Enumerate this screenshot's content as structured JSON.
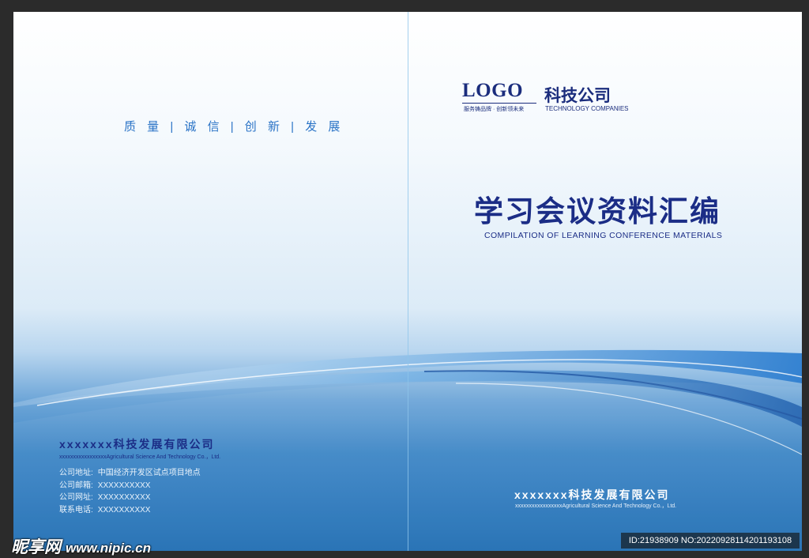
{
  "back_cover": {
    "slogan": "质 量 | 诚 信 | 创 新 | 发 展",
    "company_name": "xxxxxxx科技发展有限公司",
    "company_name_en": "xxxxxxxxxxxxxxxxxAgricultural Science And Technology Co.，Ltd.",
    "contact": [
      {
        "label": "公司地址:",
        "value": "中国经济开发区试点项目地点"
      },
      {
        "label": "公司邮箱:",
        "value": "XXXXXXXXXX"
      },
      {
        "label": "公司网址:",
        "value": "XXXXXXXXXX"
      },
      {
        "label": "联系电话:",
        "value": "XXXXXXXXXX"
      }
    ]
  },
  "front_cover": {
    "logo": "LOGO",
    "logo_tagline": "服务铸品牌 · 创新领未来",
    "company_short_cn": "科技公司",
    "company_short_en": "TECHNOLOGY COMPANIES",
    "title": "学习会议资料汇编",
    "subtitle": "COMPILATION OF LEARNING CONFERENCE MATERIALS",
    "company_name": "xxxxxxx科技发展有限公司",
    "company_name_en": "xxxxxxxxxxxxxxxxxAgricultural Science And Technology Co.，Ltd."
  },
  "watermark": {
    "brand": "昵享网",
    "url": "www.nipic.cn"
  },
  "image_id": "ID:21938909 NO:20220928114201193108",
  "colors": {
    "navy": "#1b2d86",
    "accent_blue": "#2a73c6",
    "background_dark": "#2b2b2b"
  }
}
